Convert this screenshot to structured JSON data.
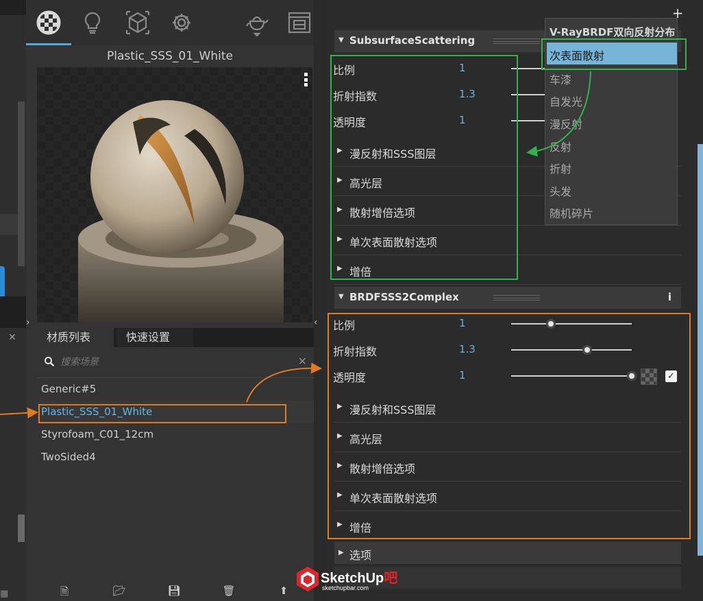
{
  "toolbar": {
    "icons": [
      "material-sphere-icon",
      "light-bulb-icon",
      "geometry-cube-icon",
      "settings-gear-icon",
      "teapot-icon",
      "render-window-icon"
    ]
  },
  "preview": {
    "title": "Plastic_SSS_01_White"
  },
  "tabs": {
    "materials": "材质列表",
    "quick": "快速设置"
  },
  "search": {
    "placeholder": "搜索场景"
  },
  "materials": [
    "Generic#5",
    "Plastic_SSS_01_White",
    "Styrofoam_C01_12cm",
    "TwoSided4"
  ],
  "materials_selected_index": 1,
  "sections": {
    "sss": {
      "title": "SubsurfaceScattering",
      "props": [
        {
          "name": "比例",
          "value": "1"
        },
        {
          "name": "折射指数",
          "value": "1.3"
        },
        {
          "name": "透明度",
          "value": "1"
        }
      ],
      "groups": [
        "漫反射和SSS图层",
        "高光层",
        "散射增倍选项",
        "单次表面散射选项",
        "增倍"
      ]
    },
    "brdf": {
      "title": "BRDFSSS2Complex",
      "info": "i",
      "props": [
        {
          "name": "比例",
          "value": "1",
          "level": 0.33
        },
        {
          "name": "折射指数",
          "value": "1.3",
          "level": 0.63
        },
        {
          "name": "透明度",
          "value": "1",
          "level": 1.0
        }
      ],
      "groups": [
        "漫反射和SSS图层",
        "高光层",
        "散射增倍选项",
        "单次表面散射选项",
        "增倍"
      ]
    },
    "options": {
      "title": "选项"
    }
  },
  "dropdown": {
    "header": "V-RayBRDF双向反射分布",
    "selected": "次表面散射",
    "items": [
      "车漆",
      "自发光",
      "漫反射",
      "反射",
      "折射",
      "头发",
      "随机碎片"
    ]
  },
  "enable_checked": true,
  "watermark": {
    "name_a": "SketchUp",
    "name_b": "吧",
    "url": "sketchupbar.com"
  },
  "colors": {
    "accent": "#5fb8e8",
    "annotation_green": "#2fb54a",
    "annotation_orange": "#e07b22"
  }
}
